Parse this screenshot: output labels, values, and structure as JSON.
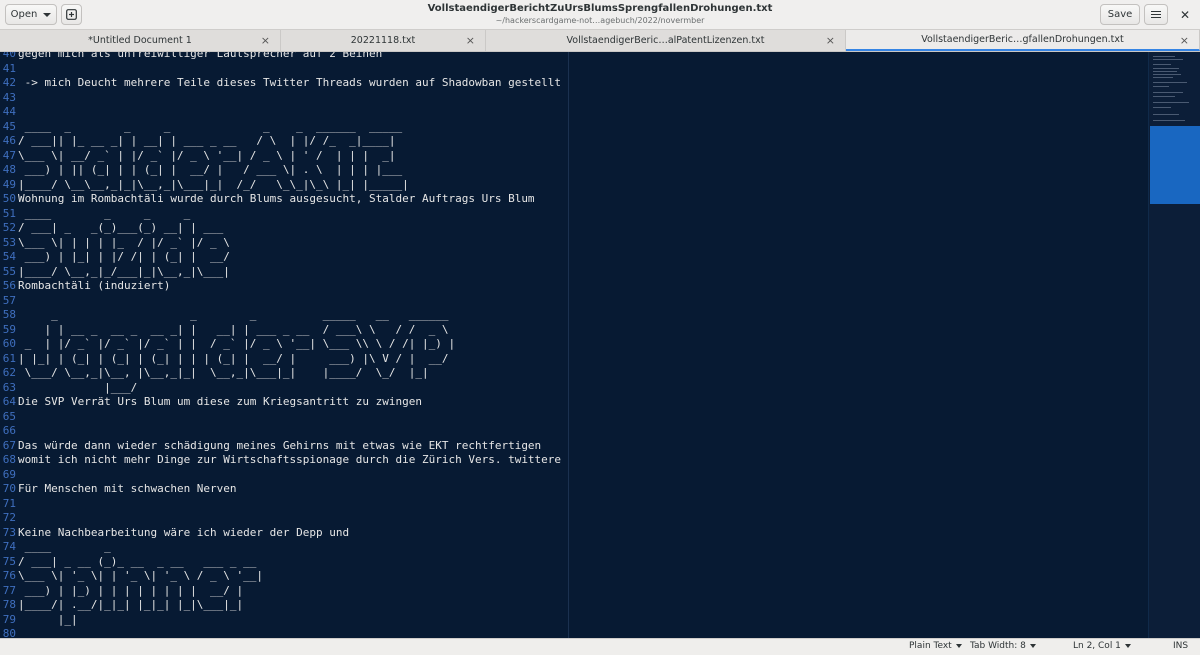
{
  "header": {
    "title": "VollstaendigerBerichtZuUrsBlumsSprengfallenDrohungen.txt",
    "subtitle": "~/hackerscardgame-not…agebuch/2022/novermber",
    "open_label": "Open",
    "save_label": "Save",
    "new_doc_icon": "new-document-icon",
    "menu_icon": "hamburger-menu-icon",
    "close_icon": "close-icon"
  },
  "tabs": [
    {
      "label": "*Untitled Document 1"
    },
    {
      "label": "20221118.txt"
    },
    {
      "label": "VollstaendigerBeric…alPatentLizenzen.txt"
    },
    {
      "label": "VollstaendigerBeric…gfallenDrohungen.txt",
      "active": true
    }
  ],
  "editor": {
    "colors": {
      "background": "#071a33",
      "line_numbers": "#3f6fbf",
      "text": "#e6e6e6"
    },
    "lines": [
      {
        "n": "40",
        "text": "gegen mich als unfreiwilliger Lautsprecher auf 2 Beinen"
      },
      {
        "n": "41",
        "text": ""
      },
      {
        "n": "42",
        "text": " -> mich Deucht mehrere Teile dieses Twitter Threads wurden auf Shadowban gestellt"
      },
      {
        "n": "43",
        "text": ""
      },
      {
        "n": "44",
        "text": ""
      },
      {
        "n": "45",
        "text": " ____  _        _     _              _    _  ______  _____"
      },
      {
        "n": "46",
        "text": "/ ___|| |_ __ _| | __| | ___ _ __   / \\  | |/ /_  _|____|"
      },
      {
        "n": "47",
        "text": "\\___ \\| __/ _` | |/ _` |/ _ \\ '__| / _ \\ | ' /  | | |  _|"
      },
      {
        "n": "48",
        "text": " ___) | || (_| | | (_| |  __/ |   / ___ \\| . \\  | | | |___"
      },
      {
        "n": "49",
        "text": "|____/ \\__\\__,_|_|\\__,_|\\___|_|  /_/   \\_\\_|\\_\\ |_| |_____|"
      },
      {
        "n": "50",
        "text": "Wohnung im Rombachtäli wurde durch Blums ausgesucht, Stalder Auftrags Urs Blum"
      },
      {
        "n": "51",
        "text": " ____        _     _     _"
      },
      {
        "n": "52",
        "text": "/ ___| _   _(_)___(_) __| | ___"
      },
      {
        "n": "53",
        "text": "\\___ \\| | | | |_  / |/ _` |/ _ \\"
      },
      {
        "n": "54",
        "text": " ___) | |_| | |/ /| | (_| |  __/"
      },
      {
        "n": "55",
        "text": "|____/ \\__,_|_/___|_|\\__,_|\\___|"
      },
      {
        "n": "56",
        "text": "Rombachtäli (induziert)"
      },
      {
        "n": "57",
        "text": ""
      },
      {
        "n": "58",
        "text": "     _                    _        _          _____   __   ______"
      },
      {
        "n": "59",
        "text": "    | | __ _  __ _  __ _| |   __| | ___ _ __  / ___\\ \\   / /  _ \\"
      },
      {
        "n": "60",
        "text": " _  | |/ _` |/ _` |/ _` | |  / _` |/ _ \\ '__| \\___ \\\\ \\ / /| |_) |"
      },
      {
        "n": "61",
        "text": "| |_| | (_| | (_| | (_| | | | (_| |  __/ |     ___) |\\ V / |  __/"
      },
      {
        "n": "62",
        "text": " \\___/ \\__,_|\\__, |\\__,_|_|  \\__,_|\\___|_|    |____/  \\_/  |_|"
      },
      {
        "n": "63",
        "text": "             |___/"
      },
      {
        "n": "64",
        "text": "Die SVP Verrät Urs Blum um diese zum Kriegsantritt zu zwingen"
      },
      {
        "n": "65",
        "text": ""
      },
      {
        "n": "66",
        "text": ""
      },
      {
        "n": "67",
        "text": "Das würde dann wieder schädigung meines Gehirns mit etwas wie EKT rechtfertigen"
      },
      {
        "n": "68",
        "text": "womit ich nicht mehr Dinge zur Wirtschaftsspionage durch die Zürich Vers. twittere"
      },
      {
        "n": "69",
        "text": ""
      },
      {
        "n": "70",
        "text": "Für Menschen mit schwachen Nerven"
      },
      {
        "n": "71",
        "text": ""
      },
      {
        "n": "72",
        "text": ""
      },
      {
        "n": "73",
        "text": "Keine Nachbearbeitung wäre ich wieder der Depp und"
      },
      {
        "n": "74",
        "text": " ____        _"
      },
      {
        "n": "75",
        "text": "/ ___| _ __ (_)_ __  _ __   ___ _ __"
      },
      {
        "n": "76",
        "text": "\\___ \\| '_ \\| | '_ \\| '_ \\ / _ \\ '__|"
      },
      {
        "n": "77",
        "text": " ___) | |_) | | | | | | | |  __/ |"
      },
      {
        "n": "78",
        "text": "|____/| .__/|_|_| |_|_| |_|\\___|_|"
      },
      {
        "n": "79",
        "text": "      |_|"
      },
      {
        "n": "80",
        "text": ""
      }
    ]
  },
  "statusbar": {
    "language": "Plain Text",
    "tab_width": "Tab Width: 8",
    "position": "Ln 2, Col 1",
    "mode": "INS"
  }
}
